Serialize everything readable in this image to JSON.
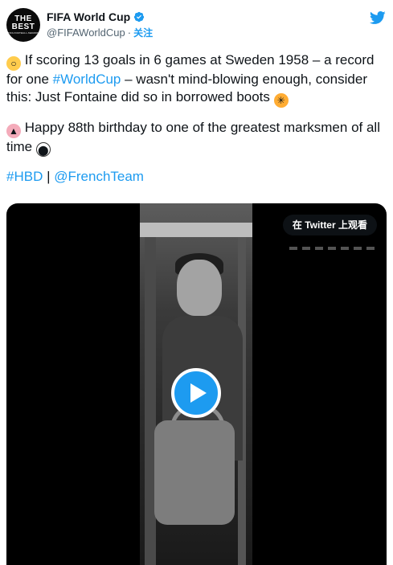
{
  "account": {
    "display_name": "FIFA World Cup",
    "handle": "@FIFAWorldCup",
    "separator": "·",
    "follow_label": "关注",
    "avatar_text_line1": "THE",
    "avatar_text_line2": "BEST",
    "avatar_text_line3": "FIFA FOOTBALL AWARDS"
  },
  "tweet": {
    "p1_part1": " If scoring 13 goals in 6 games at Sweden 1958 – a record for one ",
    "p1_hashtag": "#WorldCup",
    "p1_part2": " – wasn't mind-blowing enough, consider this: Just Fontaine did so in borrowed boots ",
    "p2_text": " Happy 88th birthday to one of the greatest marksmen of all time ",
    "p3_hashtag": "#HBD",
    "p3_sep": " | ",
    "p3_mention": "@FrenchTeam"
  },
  "video": {
    "watch_on_twitter_label": "在 Twitter 上观看"
  },
  "icons": {
    "verified": "verified-badge-icon",
    "twitter": "twitter-bird-icon",
    "play": "play-icon",
    "emoji_1": "astonished-face-emoji",
    "emoji_2": "exploding-head-emoji",
    "emoji_3": "birthday-cake-emoji",
    "emoji_4": "soccer-ball-emoji"
  },
  "colors": {
    "accent": "#1d9bf0",
    "text": "#0f1419",
    "muted": "#536471"
  }
}
